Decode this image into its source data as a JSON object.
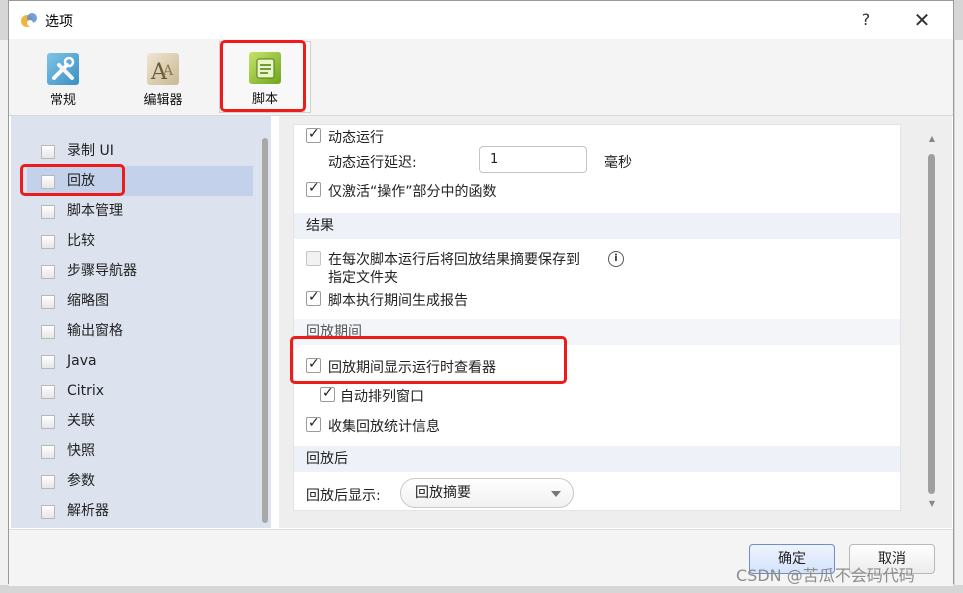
{
  "window": {
    "title": "选项",
    "help_label": "?",
    "close_label": "✕"
  },
  "toolbar": {
    "items": [
      {
        "label": "常规",
        "icon": "tools-icon"
      },
      {
        "label": "编辑器",
        "icon": "font-icon"
      },
      {
        "label": "脚本",
        "icon": "script-icon"
      }
    ],
    "selected": "脚本"
  },
  "sidebar": {
    "items": [
      {
        "label": "录制 UI"
      },
      {
        "label": "回放"
      },
      {
        "label": "脚本管理"
      },
      {
        "label": "比较"
      },
      {
        "label": "步骤导航器"
      },
      {
        "label": "缩略图"
      },
      {
        "label": "输出窗格"
      },
      {
        "label": "Java"
      },
      {
        "label": "Citrix"
      },
      {
        "label": "关联"
      },
      {
        "label": "快照"
      },
      {
        "label": "参数"
      },
      {
        "label": "解析器"
      }
    ],
    "selected": "回放"
  },
  "content": {
    "dynamic_run": {
      "label": "动态运行",
      "checked": true
    },
    "dynamic_delay": {
      "label": "动态运行延迟:",
      "value": "1",
      "unit": "毫秒"
    },
    "activate_functions": {
      "label": "仅激活“操作”部分中的函数",
      "checked": true
    },
    "results_section": "结果",
    "save_summary": {
      "label_line1": "在每次脚本运行后将回放结果摘要保存到",
      "label_line2": "指定文件夹",
      "checked": false
    },
    "generate_report": {
      "label": "脚本执行期间生成报告",
      "checked": true
    },
    "during_replay_section": "回放期间",
    "show_runtime_viewer": {
      "label": "回放期间显示运行时查看器",
      "checked": true
    },
    "auto_arrange": {
      "label": "自动排列窗口",
      "checked": true
    },
    "collect_stats": {
      "label": "收集回放统计信息",
      "checked": true
    },
    "after_replay_section": "回放后",
    "after_replay_show": {
      "label": "回放后显示:",
      "value": "回放摘要"
    }
  },
  "footer": {
    "ok_label": "确定",
    "cancel_label": "取消"
  },
  "watermark": "CSDN @苦瓜不会码代码",
  "colors": {
    "highlight": "#ee1b1b",
    "sidebar_bg": "#dce3ef",
    "selected_bg": "#c3d2ea"
  }
}
